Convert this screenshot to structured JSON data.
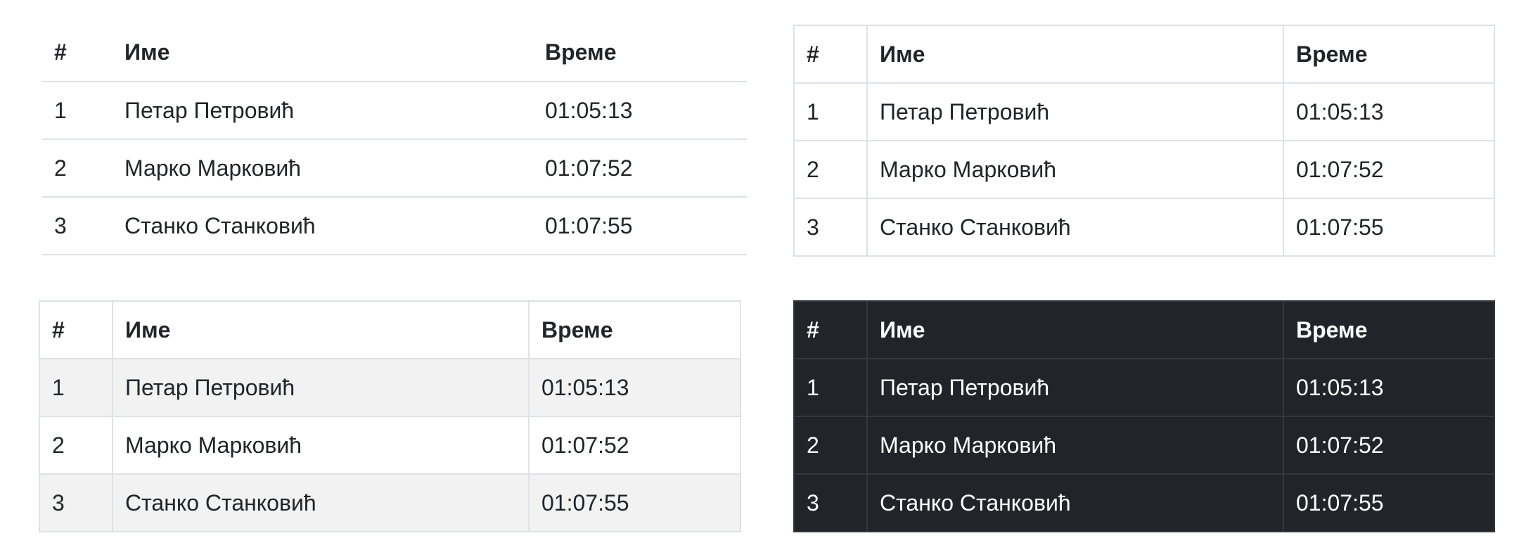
{
  "tables": [
    {
      "style": "default",
      "headers": [
        "#",
        "Име",
        "Време"
      ],
      "rows": [
        [
          "1",
          "Петар Петровић",
          "01:05:13"
        ],
        [
          "2",
          "Марко Марковић",
          "01:07:52"
        ],
        [
          "3",
          "Станко Станковић",
          "01:07:55"
        ]
      ]
    },
    {
      "style": "bordered",
      "headers": [
        "#",
        "Име",
        "Време"
      ],
      "rows": [
        [
          "1",
          "Петар Петровић",
          "01:05:13"
        ],
        [
          "2",
          "Марко Марковић",
          "01:07:52"
        ],
        [
          "3",
          "Станко Станковић",
          "01:07:55"
        ]
      ]
    },
    {
      "style": "bordered-striped",
      "headers": [
        "#",
        "Име",
        "Време"
      ],
      "rows": [
        [
          "1",
          "Петар Петровић",
          "01:05:13"
        ],
        [
          "2",
          "Марко Марковић",
          "01:07:52"
        ],
        [
          "3",
          "Станко Станковић",
          "01:07:55"
        ]
      ]
    },
    {
      "style": "dark",
      "headers": [
        "#",
        "Име",
        "Време"
      ],
      "rows": [
        [
          "1",
          "Петар Петровић",
          "01:05:13"
        ],
        [
          "2",
          "Марко Марковић",
          "01:07:52"
        ],
        [
          "3",
          "Станко Станковић",
          "01:07:55"
        ]
      ]
    }
  ],
  "colors": {
    "text": "#212529",
    "border_light": "#dee2e6",
    "stripe": "#f2f2f2",
    "dark_bg": "#212529",
    "dark_border": "#32383e",
    "dark_text": "#ffffff"
  }
}
